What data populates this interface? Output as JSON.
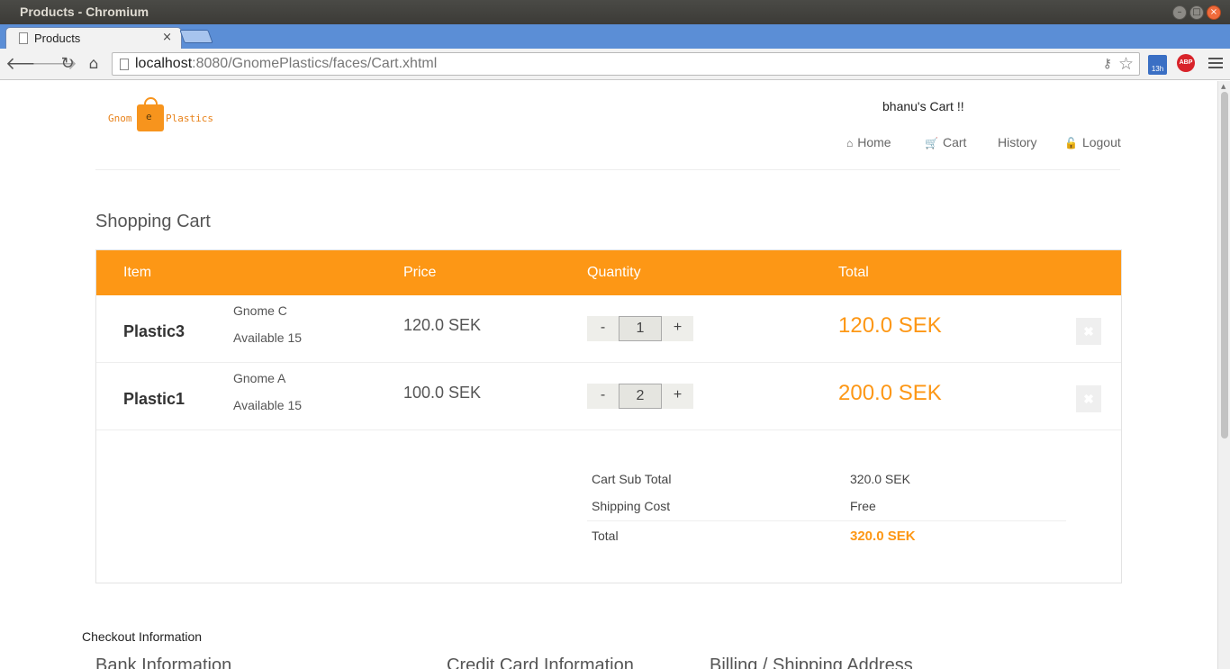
{
  "window": {
    "title": "Products - Chromium"
  },
  "tab": {
    "label": "Products",
    "close": "×"
  },
  "address": {
    "host": "localhost",
    "rest": ":8080/GnomePlastics/faces/Cart.xhtml"
  },
  "extensions": {
    "calendar_badge": "13h",
    "abp_label": "ABP"
  },
  "logo": {
    "word1": "Gnom",
    "bag_letter": "e",
    "word2": "Plastics"
  },
  "header": {
    "cart_owner": "bhanu's Cart !!",
    "nav": [
      {
        "label": "Home",
        "icon": "home-icon"
      },
      {
        "label": "Cart",
        "icon": "cart-icon"
      },
      {
        "label": "History",
        "icon": ""
      },
      {
        "label": "Logout",
        "icon": "unlock-icon"
      }
    ]
  },
  "page_title": "Shopping Cart",
  "cart": {
    "columns": [
      "Item",
      "Price",
      "Quantity",
      "Total"
    ],
    "rows": [
      {
        "name": "Plastic3",
        "description": "Gnome C",
        "availability": "Available 15",
        "price": "120.0 SEK",
        "quantity": "1",
        "total": "120.0 SEK"
      },
      {
        "name": "Plastic1",
        "description": "Gnome A",
        "availability": "Available 15",
        "price": "100.0 SEK",
        "quantity": "2",
        "total": "200.0 SEK"
      }
    ],
    "qty_minus": "-",
    "qty_plus": "+",
    "remove_symbol": "✖",
    "summary": {
      "subtotal_label": "Cart Sub Total",
      "subtotal_value": "320.0 SEK",
      "shipping_label": "Shipping Cost",
      "shipping_value": "Free",
      "total_label": "Total",
      "total_value": "320.0 SEK"
    }
  },
  "checkout": {
    "title": "Checkout Information",
    "sections": [
      "Bank Information",
      "Credit Card Information",
      "Billing / Shipping Address"
    ]
  },
  "colors": {
    "accent": "#fd9715",
    "tabstrip": "#5b8ed6"
  }
}
